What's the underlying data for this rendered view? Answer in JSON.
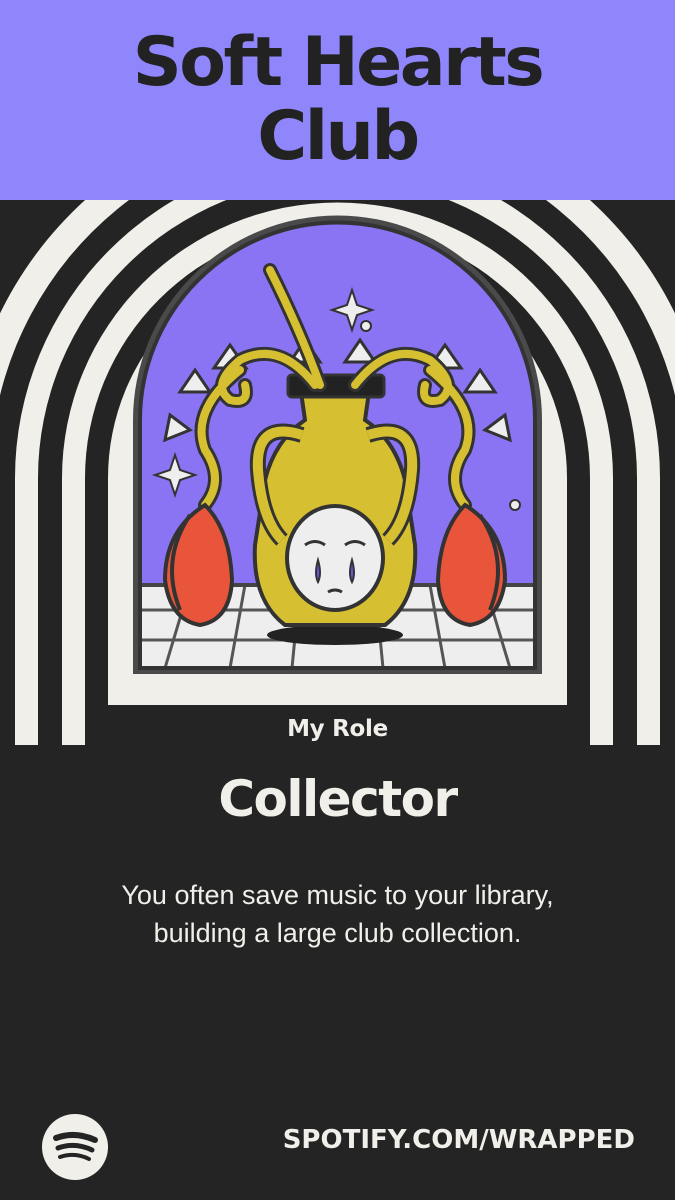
{
  "header": {
    "title_line1": "Soft Hearts",
    "title_line2": "Club",
    "background_color": "#8f86fb"
  },
  "badge": {
    "icon": "enamel-pin-vase-icon"
  },
  "role": {
    "label": "My Role",
    "name": "Collector",
    "description": "You often save music to your library, building a large club collection."
  },
  "footer": {
    "logo_icon": "spotify-logo-icon",
    "url": "SPOTIFY.COM/WRAPPED"
  },
  "colors": {
    "background": "#242424",
    "arch_stripes": "#f1efe9",
    "pin_purple": "#8a74f4",
    "pin_gold": "#d7bf32",
    "pin_flower": "#e8553a"
  }
}
